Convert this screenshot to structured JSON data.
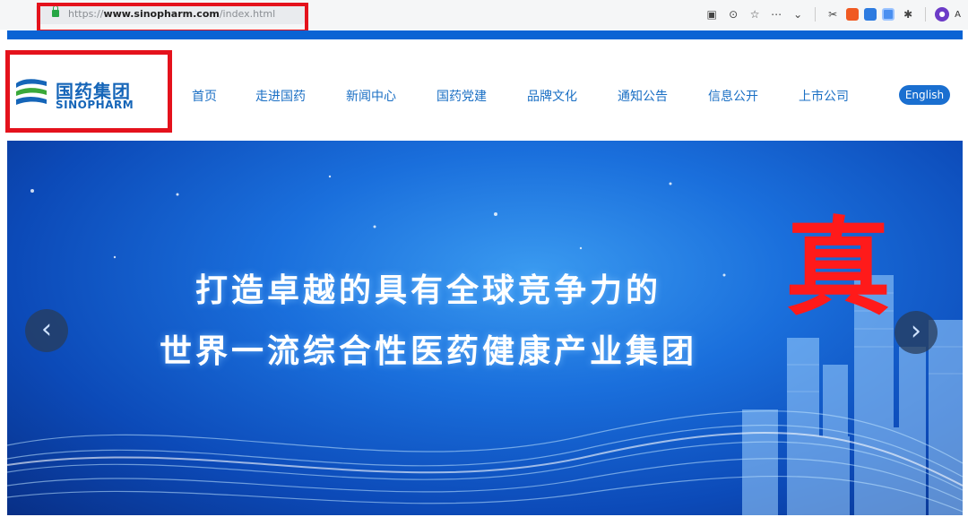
{
  "browser": {
    "url_prefix": "https://",
    "url_domain": "www.sinopharm.com",
    "url_path": "/index.html",
    "profile_letter": "A"
  },
  "site": {
    "logo_cn": "国药集团",
    "logo_en": "SINOPHARM",
    "nav": [
      "首页",
      "走进国药",
      "新闻中心",
      "国药党建",
      "品牌文化",
      "通知公告",
      "信息公开",
      "上市公司"
    ],
    "english_label": "English"
  },
  "banner": {
    "slogan_line1": "打造卓越的具有全球竞争力的",
    "slogan_line2": "世界一流综合性医药健康产业集团",
    "prev_glyph": "‹",
    "next_glyph": "›"
  },
  "annotation": {
    "stamp_text": "真"
  },
  "colors": {
    "brand_blue": "#1a6fc4",
    "highlight_red": "#e4121c"
  }
}
